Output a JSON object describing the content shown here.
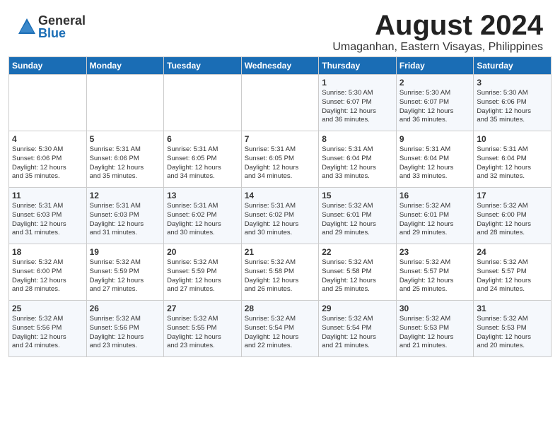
{
  "logo": {
    "general": "General",
    "blue": "Blue"
  },
  "title": "August 2024",
  "location": "Umaganhan, Eastern Visayas, Philippines",
  "weekdays": [
    "Sunday",
    "Monday",
    "Tuesday",
    "Wednesday",
    "Thursday",
    "Friday",
    "Saturday"
  ],
  "weeks": [
    [
      {
        "day": "",
        "info": ""
      },
      {
        "day": "",
        "info": ""
      },
      {
        "day": "",
        "info": ""
      },
      {
        "day": "",
        "info": ""
      },
      {
        "day": "1",
        "info": "Sunrise: 5:30 AM\nSunset: 6:07 PM\nDaylight: 12 hours\nand 36 minutes."
      },
      {
        "day": "2",
        "info": "Sunrise: 5:30 AM\nSunset: 6:07 PM\nDaylight: 12 hours\nand 36 minutes."
      },
      {
        "day": "3",
        "info": "Sunrise: 5:30 AM\nSunset: 6:06 PM\nDaylight: 12 hours\nand 35 minutes."
      }
    ],
    [
      {
        "day": "4",
        "info": "Sunrise: 5:30 AM\nSunset: 6:06 PM\nDaylight: 12 hours\nand 35 minutes."
      },
      {
        "day": "5",
        "info": "Sunrise: 5:31 AM\nSunset: 6:06 PM\nDaylight: 12 hours\nand 35 minutes."
      },
      {
        "day": "6",
        "info": "Sunrise: 5:31 AM\nSunset: 6:05 PM\nDaylight: 12 hours\nand 34 minutes."
      },
      {
        "day": "7",
        "info": "Sunrise: 5:31 AM\nSunset: 6:05 PM\nDaylight: 12 hours\nand 34 minutes."
      },
      {
        "day": "8",
        "info": "Sunrise: 5:31 AM\nSunset: 6:04 PM\nDaylight: 12 hours\nand 33 minutes."
      },
      {
        "day": "9",
        "info": "Sunrise: 5:31 AM\nSunset: 6:04 PM\nDaylight: 12 hours\nand 33 minutes."
      },
      {
        "day": "10",
        "info": "Sunrise: 5:31 AM\nSunset: 6:04 PM\nDaylight: 12 hours\nand 32 minutes."
      }
    ],
    [
      {
        "day": "11",
        "info": "Sunrise: 5:31 AM\nSunset: 6:03 PM\nDaylight: 12 hours\nand 31 minutes."
      },
      {
        "day": "12",
        "info": "Sunrise: 5:31 AM\nSunset: 6:03 PM\nDaylight: 12 hours\nand 31 minutes."
      },
      {
        "day": "13",
        "info": "Sunrise: 5:31 AM\nSunset: 6:02 PM\nDaylight: 12 hours\nand 30 minutes."
      },
      {
        "day": "14",
        "info": "Sunrise: 5:31 AM\nSunset: 6:02 PM\nDaylight: 12 hours\nand 30 minutes."
      },
      {
        "day": "15",
        "info": "Sunrise: 5:32 AM\nSunset: 6:01 PM\nDaylight: 12 hours\nand 29 minutes."
      },
      {
        "day": "16",
        "info": "Sunrise: 5:32 AM\nSunset: 6:01 PM\nDaylight: 12 hours\nand 29 minutes."
      },
      {
        "day": "17",
        "info": "Sunrise: 5:32 AM\nSunset: 6:00 PM\nDaylight: 12 hours\nand 28 minutes."
      }
    ],
    [
      {
        "day": "18",
        "info": "Sunrise: 5:32 AM\nSunset: 6:00 PM\nDaylight: 12 hours\nand 28 minutes."
      },
      {
        "day": "19",
        "info": "Sunrise: 5:32 AM\nSunset: 5:59 PM\nDaylight: 12 hours\nand 27 minutes."
      },
      {
        "day": "20",
        "info": "Sunrise: 5:32 AM\nSunset: 5:59 PM\nDaylight: 12 hours\nand 27 minutes."
      },
      {
        "day": "21",
        "info": "Sunrise: 5:32 AM\nSunset: 5:58 PM\nDaylight: 12 hours\nand 26 minutes."
      },
      {
        "day": "22",
        "info": "Sunrise: 5:32 AM\nSunset: 5:58 PM\nDaylight: 12 hours\nand 25 minutes."
      },
      {
        "day": "23",
        "info": "Sunrise: 5:32 AM\nSunset: 5:57 PM\nDaylight: 12 hours\nand 25 minutes."
      },
      {
        "day": "24",
        "info": "Sunrise: 5:32 AM\nSunset: 5:57 PM\nDaylight: 12 hours\nand 24 minutes."
      }
    ],
    [
      {
        "day": "25",
        "info": "Sunrise: 5:32 AM\nSunset: 5:56 PM\nDaylight: 12 hours\nand 24 minutes."
      },
      {
        "day": "26",
        "info": "Sunrise: 5:32 AM\nSunset: 5:56 PM\nDaylight: 12 hours\nand 23 minutes."
      },
      {
        "day": "27",
        "info": "Sunrise: 5:32 AM\nSunset: 5:55 PM\nDaylight: 12 hours\nand 23 minutes."
      },
      {
        "day": "28",
        "info": "Sunrise: 5:32 AM\nSunset: 5:54 PM\nDaylight: 12 hours\nand 22 minutes."
      },
      {
        "day": "29",
        "info": "Sunrise: 5:32 AM\nSunset: 5:54 PM\nDaylight: 12 hours\nand 21 minutes."
      },
      {
        "day": "30",
        "info": "Sunrise: 5:32 AM\nSunset: 5:53 PM\nDaylight: 12 hours\nand 21 minutes."
      },
      {
        "day": "31",
        "info": "Sunrise: 5:32 AM\nSunset: 5:53 PM\nDaylight: 12 hours\nand 20 minutes."
      }
    ]
  ]
}
